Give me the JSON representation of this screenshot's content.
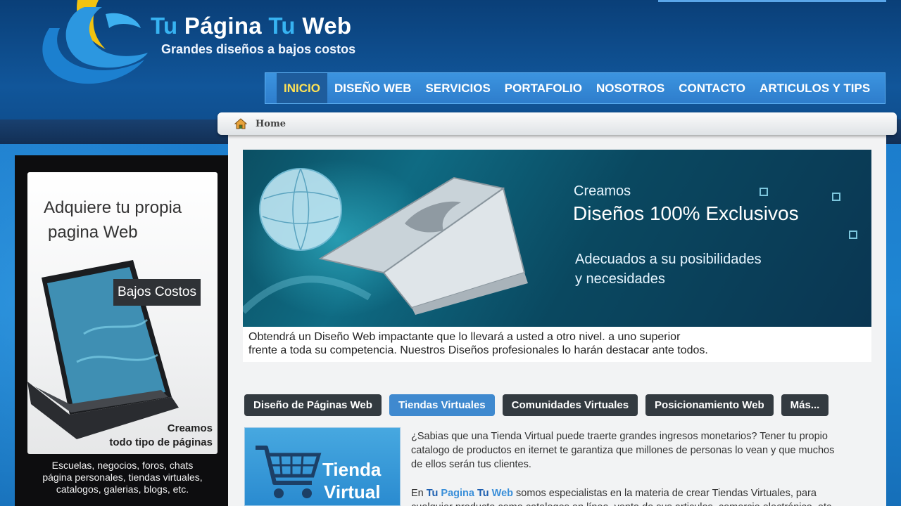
{
  "header": {
    "brand_part1": "Tu",
    "brand_part2": " Página ",
    "brand_part3": "Tu",
    "brand_part4": " Web",
    "slogan": "Grandes diseños a bajos costos"
  },
  "nav": {
    "items": [
      {
        "label": "INICIO",
        "active": true
      },
      {
        "label": "DISEÑO WEB"
      },
      {
        "label": "SERVICIOS"
      },
      {
        "label": "PORTAFOLIO"
      },
      {
        "label": "NOSOTROS"
      },
      {
        "label": "CONTACTO"
      },
      {
        "label": "ARTICULOS Y TIPS"
      }
    ]
  },
  "breadcrumb": {
    "home": "Home",
    "icon": "home-icon"
  },
  "banner": {
    "line1": "Creamos",
    "line2": "Diseños 100% Exclusivos",
    "line3": "Adecuados a su posibilidades",
    "line4": "y necesidades",
    "caption1": "Obtendrá un Diseño Web impactante que lo llevará a usted a otro nivel. a uno superior",
    "caption2": "frente a toda su competencia. Nuestros Diseños profesionales lo harán destacar ante todos."
  },
  "tabs": [
    {
      "label": "Diseño de Páginas Web"
    },
    {
      "label": "Tiendas Virtuales",
      "active": true
    },
    {
      "label": "Comunidades Virtuales"
    },
    {
      "label": "Posicionamiento Web"
    },
    {
      "label": "Más..."
    }
  ],
  "content": {
    "image_title1": "Tienda",
    "image_title2": "Virtual",
    "p1_line1": "¿Sabias que una Tienda Virtual puede traerte grandes ingresos monetarios? Tener tu propio",
    "p1_line2": "catalogo de productos en iternet te garantiza que millones de personas lo vean y que muchos",
    "p1_line3": "de ellos serán tus clientes.",
    "p2_prefix": "En ",
    "p2_brand_a": "Tu",
    "p2_brand_b": " Pagina ",
    "p2_brand_c": "Tu",
    "p2_brand_d": " Web",
    "p2_rest": " somos especialistas en la materia de crear Tiendas Virtuales, para",
    "p2_line2": "cualquier producto como catalogos en línea, venta de sus articulos, comercio electrónico, etc."
  },
  "sidebar": {
    "heading1": "Adquiere tu propia",
    "heading2": "pagina Web",
    "badge": "Bajos Costos",
    "caption1": "Creamos",
    "caption2": "todo tipo de páginas",
    "text_line1": "Escuelas, negocios, foros, chats",
    "text_line2": "página personales, tiendas virtuales,",
    "text_line3": "catalogos, galerias, blogs, etc."
  },
  "colors": {
    "accent_blue": "#3f89cf",
    "nav_active_text": "#ffe255",
    "brand_light": "#37b3f2",
    "dark_tab": "#333a40"
  }
}
